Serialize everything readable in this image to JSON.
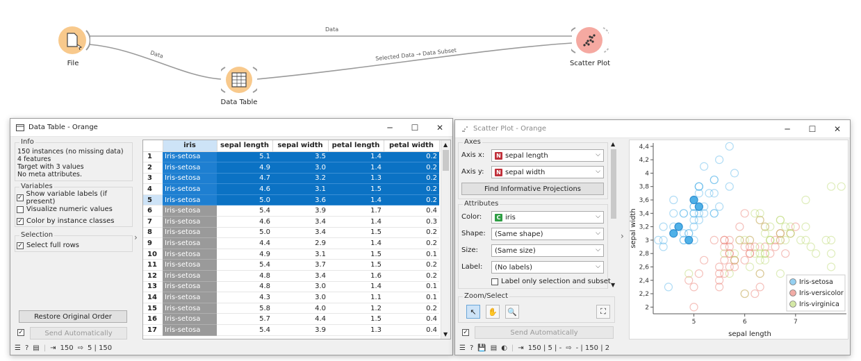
{
  "canvas": {
    "nodes": {
      "file": "File",
      "data_table": "Data Table",
      "scatter_plot": "Scatter Plot"
    },
    "links": {
      "file_scatter": "Data",
      "file_table": "Data",
      "table_scatter": "Selected Data → Data Subset"
    },
    "colors": {
      "file": "#f8c98c",
      "table": "#f8c98c",
      "scatter": "#f5a9a1"
    }
  },
  "data_table": {
    "title": "Data Table - Orange",
    "info_title": "Info",
    "info_lines": [
      "150 instances (no missing data)",
      "4  features",
      "Target with 3 values",
      "No meta attributes."
    ],
    "variables_title": "Variables",
    "variables": [
      {
        "label": "Show variable labels (if present)",
        "checked": true
      },
      {
        "label": "Visualize numeric values",
        "checked": false
      },
      {
        "label": "Color by instance classes",
        "checked": true
      }
    ],
    "selection_title": "Selection",
    "select_full_rows": "Select full rows",
    "restore_label": "Restore Original Order",
    "send_label": "Send Automatically",
    "status": {
      "in": "150",
      "out": "5 | 150"
    },
    "columns": [
      "iris",
      "sepal length",
      "sepal width",
      "petal length",
      "petal width"
    ],
    "rows": [
      {
        "n": "1",
        "c": "Iris-setosa",
        "v": [
          "5.1",
          "3.5",
          "1.4",
          "0.2"
        ],
        "sel": true
      },
      {
        "n": "2",
        "c": "Iris-setosa",
        "v": [
          "4.9",
          "3.0",
          "1.4",
          "0.2"
        ],
        "sel": true
      },
      {
        "n": "3",
        "c": "Iris-setosa",
        "v": [
          "4.7",
          "3.2",
          "1.3",
          "0.2"
        ],
        "sel": true
      },
      {
        "n": "4",
        "c": "Iris-setosa",
        "v": [
          "4.6",
          "3.1",
          "1.5",
          "0.2"
        ],
        "sel": true
      },
      {
        "n": "5",
        "c": "Iris-setosa",
        "v": [
          "5.0",
          "3.6",
          "1.4",
          "0.2"
        ],
        "sel": true
      },
      {
        "n": "6",
        "c": "Iris-setosa",
        "v": [
          "5.4",
          "3.9",
          "1.7",
          "0.4"
        ],
        "sel": false
      },
      {
        "n": "7",
        "c": "Iris-setosa",
        "v": [
          "4.6",
          "3.4",
          "1.4",
          "0.3"
        ],
        "sel": false
      },
      {
        "n": "8",
        "c": "Iris-setosa",
        "v": [
          "5.0",
          "3.4",
          "1.5",
          "0.2"
        ],
        "sel": false
      },
      {
        "n": "9",
        "c": "Iris-setosa",
        "v": [
          "4.4",
          "2.9",
          "1.4",
          "0.2"
        ],
        "sel": false
      },
      {
        "n": "10",
        "c": "Iris-setosa",
        "v": [
          "4.9",
          "3.1",
          "1.5",
          "0.1"
        ],
        "sel": false
      },
      {
        "n": "11",
        "c": "Iris-setosa",
        "v": [
          "5.4",
          "3.7",
          "1.5",
          "0.2"
        ],
        "sel": false
      },
      {
        "n": "12",
        "c": "Iris-setosa",
        "v": [
          "4.8",
          "3.4",
          "1.6",
          "0.2"
        ],
        "sel": false
      },
      {
        "n": "13",
        "c": "Iris-setosa",
        "v": [
          "4.8",
          "3.0",
          "1.4",
          "0.1"
        ],
        "sel": false
      },
      {
        "n": "14",
        "c": "Iris-setosa",
        "v": [
          "4.3",
          "3.0",
          "1.1",
          "0.1"
        ],
        "sel": false
      },
      {
        "n": "15",
        "c": "Iris-setosa",
        "v": [
          "5.8",
          "4.0",
          "1.2",
          "0.2"
        ],
        "sel": false
      },
      {
        "n": "16",
        "c": "Iris-setosa",
        "v": [
          "5.7",
          "4.4",
          "1.5",
          "0.4"
        ],
        "sel": false
      },
      {
        "n": "17",
        "c": "Iris-setosa",
        "v": [
          "5.4",
          "3.9",
          "1.3",
          "0.4"
        ],
        "sel": false
      }
    ]
  },
  "scatter": {
    "title": "Scatter Plot - Orange",
    "axes_title": "Axes",
    "axis_x_label": "Axis x:",
    "axis_x_value": "sepal length",
    "axis_y_label": "Axis y:",
    "axis_y_value": "sepal width",
    "find_label": "Find Informative Projections",
    "attributes_title": "Attributes",
    "color_label": "Color:",
    "color_value": "iris",
    "shape_label": "Shape:",
    "shape_value": "(Same shape)",
    "size_label": "Size:",
    "size_value": "(Same size)",
    "label_label": "Label:",
    "label_value": "(No labels)",
    "label_only": "Label only selection and subset",
    "zoom_title": "Zoom/Select",
    "send_label": "Send Automatically",
    "status": {
      "in": "150 | 5 | -",
      "out": "- | 150 | 2"
    },
    "badge_numeric": "N",
    "badge_categorical": "C"
  },
  "chart_data": {
    "type": "scatter",
    "xlabel": "sepal length",
    "ylabel": "sepal width",
    "xlim": [
      4.2,
      8.0
    ],
    "ylim": [
      1.9,
      4.45
    ],
    "xticks": [
      "5",
      "6",
      "7"
    ],
    "yticks": [
      "2",
      "2,2",
      "2,4",
      "2,6",
      "2,8",
      "3",
      "3,2",
      "3,4",
      "3,6",
      "3,8",
      "4",
      "4,2",
      "4,4"
    ],
    "legend": [
      "Iris-setosa",
      "Iris-versicolor",
      "Iris-virginica"
    ],
    "colors": [
      "#4fb1e8",
      "#e8756b",
      "#b8d86a"
    ],
    "highlighted": [
      [
        5.1,
        3.5
      ],
      [
        4.9,
        3.0
      ],
      [
        4.7,
        3.2
      ],
      [
        4.6,
        3.1
      ],
      [
        5.0,
        3.6
      ]
    ],
    "series": [
      {
        "name": "Iris-setosa",
        "points": [
          [
            5.4,
            3.9
          ],
          [
            4.6,
            3.4
          ],
          [
            5.0,
            3.4
          ],
          [
            4.4,
            2.9
          ],
          [
            4.9,
            3.1
          ],
          [
            5.4,
            3.7
          ],
          [
            4.8,
            3.4
          ],
          [
            4.8,
            3.0
          ],
          [
            4.3,
            3.0
          ],
          [
            5.8,
            4.0
          ],
          [
            5.7,
            4.4
          ],
          [
            5.4,
            3.9
          ],
          [
            5.1,
            3.5
          ],
          [
            5.7,
            3.8
          ],
          [
            5.1,
            3.8
          ],
          [
            5.4,
            3.4
          ],
          [
            5.1,
            3.7
          ],
          [
            4.6,
            3.6
          ],
          [
            5.1,
            3.3
          ],
          [
            4.8,
            3.4
          ],
          [
            5.0,
            3.0
          ],
          [
            5.0,
            3.4
          ],
          [
            5.2,
            3.5
          ],
          [
            5.2,
            3.4
          ],
          [
            4.7,
            3.2
          ],
          [
            4.8,
            3.1
          ],
          [
            5.4,
            3.4
          ],
          [
            5.2,
            4.1
          ],
          [
            5.5,
            4.2
          ],
          [
            4.9,
            3.1
          ],
          [
            5.0,
            3.2
          ],
          [
            5.5,
            3.5
          ],
          [
            4.4,
            3.0
          ],
          [
            5.1,
            3.4
          ],
          [
            5.0,
            3.5
          ],
          [
            4.5,
            2.3
          ],
          [
            4.4,
            3.2
          ],
          [
            5.0,
            3.5
          ],
          [
            5.1,
            3.8
          ],
          [
            4.8,
            3.0
          ],
          [
            5.1,
            3.8
          ],
          [
            4.6,
            3.2
          ],
          [
            5.3,
            3.7
          ],
          [
            5.0,
            3.3
          ]
        ]
      },
      {
        "name": "Iris-versicolor",
        "points": [
          [
            7.0,
            3.2
          ],
          [
            6.4,
            3.2
          ],
          [
            6.9,
            3.1
          ],
          [
            5.5,
            2.3
          ],
          [
            6.5,
            2.8
          ],
          [
            5.7,
            2.8
          ],
          [
            6.3,
            3.3
          ],
          [
            4.9,
            2.4
          ],
          [
            6.6,
            2.9
          ],
          [
            5.2,
            2.7
          ],
          [
            5.0,
            2.0
          ],
          [
            5.9,
            3.0
          ],
          [
            6.0,
            2.2
          ],
          [
            6.1,
            2.9
          ],
          [
            5.6,
            2.9
          ],
          [
            6.7,
            3.1
          ],
          [
            5.6,
            3.0
          ],
          [
            5.8,
            2.7
          ],
          [
            6.2,
            2.2
          ],
          [
            5.6,
            2.5
          ],
          [
            5.9,
            3.2
          ],
          [
            6.1,
            2.8
          ],
          [
            6.3,
            2.5
          ],
          [
            6.1,
            2.8
          ],
          [
            6.4,
            2.9
          ],
          [
            6.6,
            3.0
          ],
          [
            6.8,
            2.8
          ],
          [
            6.7,
            3.0
          ],
          [
            6.0,
            2.9
          ],
          [
            5.7,
            2.6
          ],
          [
            5.5,
            2.4
          ],
          [
            5.8,
            2.7
          ],
          [
            6.0,
            2.7
          ],
          [
            5.4,
            3.0
          ],
          [
            6.0,
            3.4
          ],
          [
            6.7,
            3.1
          ],
          [
            6.3,
            2.3
          ],
          [
            5.6,
            3.0
          ],
          [
            5.5,
            2.5
          ],
          [
            5.5,
            2.6
          ],
          [
            6.1,
            3.0
          ],
          [
            5.8,
            2.6
          ],
          [
            5.0,
            2.3
          ],
          [
            5.6,
            2.7
          ],
          [
            5.7,
            3.0
          ],
          [
            5.7,
            2.9
          ],
          [
            6.2,
            2.9
          ],
          [
            5.1,
            2.5
          ],
          [
            5.7,
            2.8
          ]
        ]
      },
      {
        "name": "Iris-virginica",
        "points": [
          [
            6.3,
            3.3
          ],
          [
            5.8,
            2.7
          ],
          [
            7.1,
            3.0
          ],
          [
            6.3,
            2.9
          ],
          [
            6.5,
            3.0
          ],
          [
            7.6,
            3.0
          ],
          [
            4.9,
            2.5
          ],
          [
            7.3,
            2.9
          ],
          [
            6.7,
            2.5
          ],
          [
            7.2,
            3.6
          ],
          [
            6.5,
            3.2
          ],
          [
            6.4,
            2.7
          ],
          [
            6.8,
            3.0
          ],
          [
            5.7,
            2.5
          ],
          [
            5.8,
            2.8
          ],
          [
            6.4,
            3.2
          ],
          [
            6.5,
            3.0
          ],
          [
            7.7,
            3.8
          ],
          [
            7.7,
            2.6
          ],
          [
            6.0,
            2.2
          ],
          [
            6.9,
            3.2
          ],
          [
            5.6,
            2.8
          ],
          [
            7.7,
            2.8
          ],
          [
            6.3,
            2.7
          ],
          [
            6.7,
            3.3
          ],
          [
            7.2,
            3.2
          ],
          [
            6.2,
            2.8
          ],
          [
            6.1,
            3.0
          ],
          [
            6.4,
            2.8
          ],
          [
            7.2,
            3.0
          ],
          [
            7.4,
            2.8
          ],
          [
            7.9,
            3.8
          ],
          [
            6.4,
            2.8
          ],
          [
            6.3,
            2.8
          ],
          [
            6.1,
            2.6
          ],
          [
            7.7,
            3.0
          ],
          [
            6.3,
            3.4
          ],
          [
            6.4,
            3.1
          ],
          [
            6.0,
            3.0
          ],
          [
            6.9,
            3.1
          ],
          [
            6.7,
            3.1
          ],
          [
            6.9,
            3.1
          ],
          [
            6.8,
            3.2
          ],
          [
            6.7,
            3.3
          ],
          [
            6.7,
            3.0
          ],
          [
            6.3,
            2.5
          ],
          [
            6.5,
            3.0
          ],
          [
            6.2,
            3.4
          ],
          [
            5.9,
            3.0
          ]
        ]
      }
    ]
  }
}
